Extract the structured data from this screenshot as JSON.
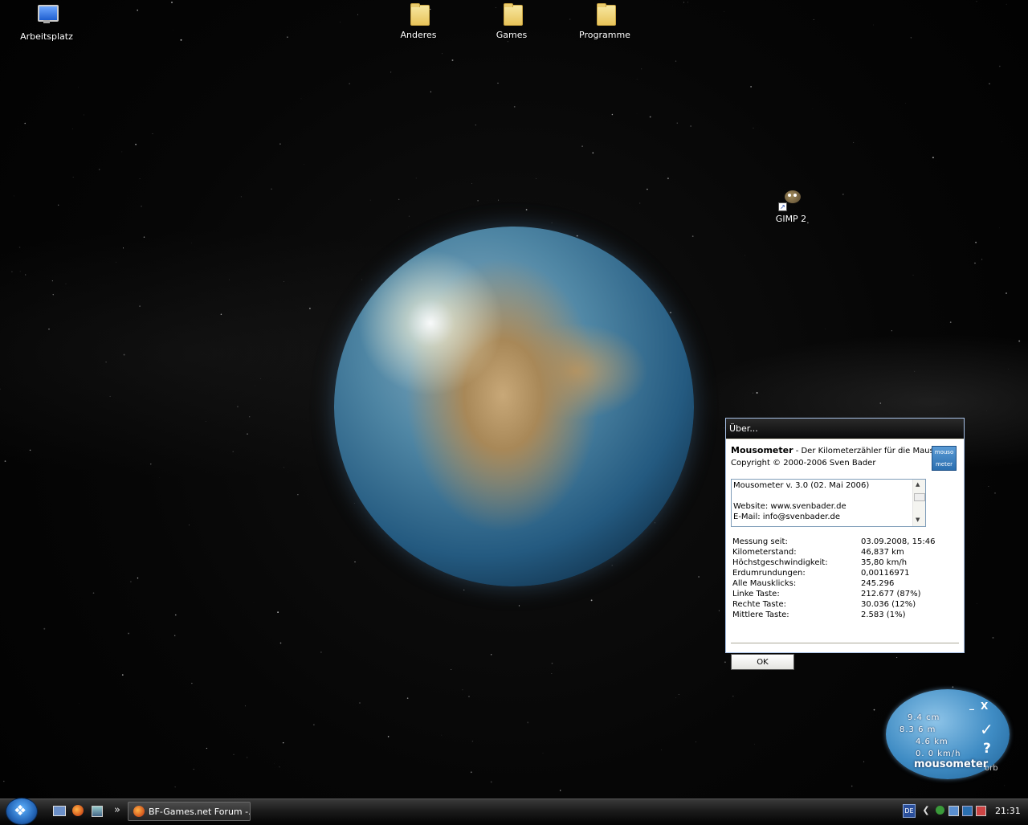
{
  "desktop": {
    "icons": [
      {
        "label": "Arbeitsplatz"
      },
      {
        "label": "Anderes"
      },
      {
        "label": "Games"
      },
      {
        "label": "Programme"
      },
      {
        "label": "GIMP 2"
      }
    ]
  },
  "dialog": {
    "title": "Über...",
    "app_name": "Mousometer",
    "app_tagline": " - Der Kilometerzähler für die Maus",
    "copyright": "Copyright © 2000-2006 Sven Bader",
    "logo_text_1": "mouso",
    "logo_text_2": "meter",
    "info_version": "Mousometer v. 3.0 (02. Mai 2006)",
    "info_website": "Website: www.svenbader.de",
    "info_email": "E-Mail: info@svenbader.de",
    "stats": [
      {
        "key": "Messung seit:",
        "value": "03.09.2008, 15:46"
      },
      {
        "key": "Kilometerstand:",
        "value": "46,837 km"
      },
      {
        "key": "Höchstgeschwindigkeit:",
        "value": "35,80 km/h"
      },
      {
        "key": "Erdumrundungen:",
        "value": "0,00116971"
      },
      {
        "key": "Alle Mausklicks:",
        "value": "245.296"
      },
      {
        "key": "Linke Taste:",
        "value": "212.677 (87%)"
      },
      {
        "key": "Rechte Taste:",
        "value": "30.036 (12%)"
      },
      {
        "key": "Mittlere Taste:",
        "value": "2.583 (1%)"
      }
    ],
    "ok_label": "OK"
  },
  "orb_widget": {
    "lines": [
      "9.4 cm",
      "8.3 6 m",
      "4.6 km",
      "0. 0 km/h"
    ],
    "brand": "mousometer",
    "minimize": "_",
    "close": "X",
    "check": "✓",
    "help": "?",
    "tag": "orb"
  },
  "taskbar": {
    "task_button_label": "BF-Games.net Forum -...",
    "overflow": "»",
    "language": "DE",
    "clock": "21:31"
  },
  "colors": {
    "dialog_title_bg": "#0a0a0a",
    "taskbar_bg": "#1a1a1a",
    "orb_blue": "#3f8cc4"
  }
}
